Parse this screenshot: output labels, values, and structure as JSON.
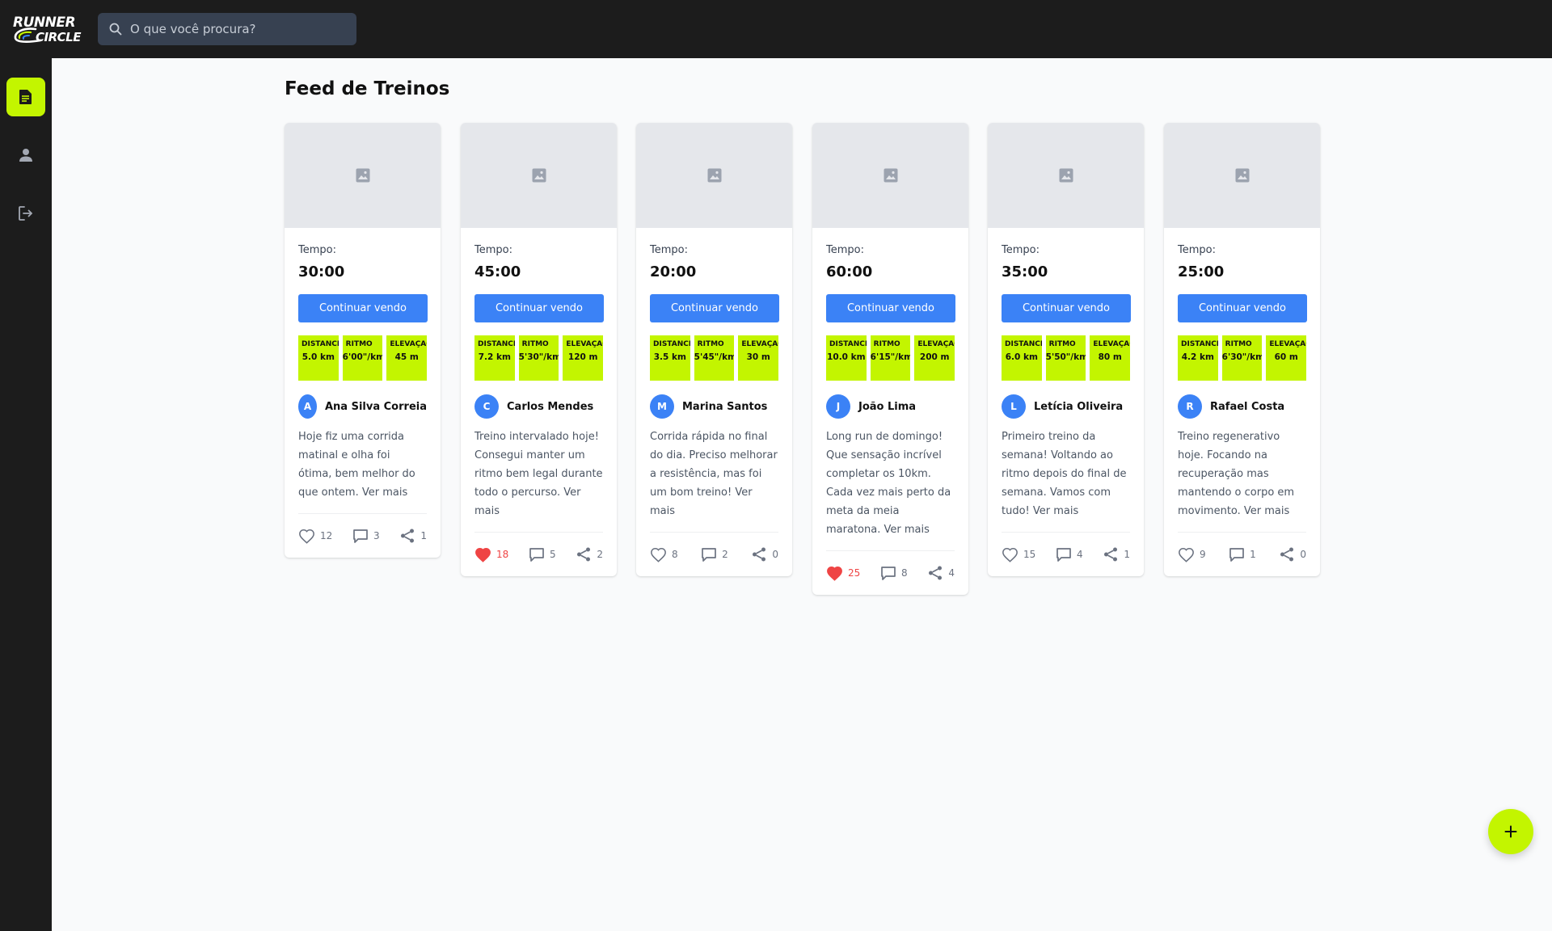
{
  "app": {
    "logo_line1": "RUNNER",
    "logo_line2": "CIRCLE"
  },
  "search": {
    "placeholder": "O que você procura?",
    "icon": "search-icon"
  },
  "sidebar": {
    "items": [
      {
        "icon": "feed-document-icon",
        "active": true
      },
      {
        "icon": "user-icon",
        "active": false
      },
      {
        "icon": "logout-icon",
        "active": false
      }
    ],
    "accent": "#c3f500"
  },
  "page_title": "Feed de Treinos",
  "colors": {
    "topbar": "#1c1c1c",
    "primary_button": "#3b82f6",
    "stat_bg": "#c3f500",
    "liked": "#ef4444"
  },
  "posts": [
    {
      "time_label": "Tempo:",
      "time": "30:00",
      "cta": "Continuar vendo",
      "stats": [
        {
          "label": "DISTÂNCIA",
          "value": "5.0 km"
        },
        {
          "label": "RITMO",
          "value": "6'00\"/km"
        },
        {
          "label": "ELEVAÇÃO",
          "value": "45 m"
        }
      ],
      "avatar": "A",
      "author": "Ana Silva Correia",
      "text": "Hoje fiz uma corrida matinal e olha foi ótima, bem melhor do que ontem. Ver mais",
      "likes": "12",
      "liked": false,
      "comments": "3",
      "shares": "1"
    },
    {
      "time_label": "Tempo:",
      "time": "45:00",
      "cta": "Continuar vendo",
      "stats": [
        {
          "label": "DISTÂNCIA",
          "value": "7.2 km"
        },
        {
          "label": "RITMO",
          "value": "5'30\"/km"
        },
        {
          "label": "ELEVAÇÃO",
          "value": "120 m"
        }
      ],
      "avatar": "C",
      "author": "Carlos Mendes",
      "text": "Treino intervalado hoje! Consegui manter um ritmo bem legal durante todo o percurso. Ver mais",
      "likes": "18",
      "liked": true,
      "comments": "5",
      "shares": "2"
    },
    {
      "time_label": "Tempo:",
      "time": "20:00",
      "cta": "Continuar vendo",
      "stats": [
        {
          "label": "DISTÂNCIA",
          "value": "3.5 km"
        },
        {
          "label": "RITMO",
          "value": "5'45\"/km"
        },
        {
          "label": "ELEVAÇÃO",
          "value": "30 m"
        }
      ],
      "avatar": "M",
      "author": "Marina Santos",
      "text": "Corrida rápida no final do dia. Preciso melhorar a resistência, mas foi um bom treino! Ver mais",
      "likes": "8",
      "liked": false,
      "comments": "2",
      "shares": "0"
    },
    {
      "time_label": "Tempo:",
      "time": "60:00",
      "cta": "Continuar vendo",
      "stats": [
        {
          "label": "DISTÂNCIA",
          "value": "10.0 km"
        },
        {
          "label": "RITMO",
          "value": "6'15\"/km"
        },
        {
          "label": "ELEVAÇÃO",
          "value": "200 m"
        }
      ],
      "avatar": "J",
      "author": "João Lima",
      "text": "Long run de domingo! Que sensação incrível completar os 10km. Cada vez mais perto da meta da meia maratona. Ver mais",
      "likes": "25",
      "liked": true,
      "comments": "8",
      "shares": "4"
    },
    {
      "time_label": "Tempo:",
      "time": "35:00",
      "cta": "Continuar vendo",
      "stats": [
        {
          "label": "DISTÂNCIA",
          "value": "6.0 km"
        },
        {
          "label": "RITMO",
          "value": "5'50\"/km"
        },
        {
          "label": "ELEVAÇÃO",
          "value": "80 m"
        }
      ],
      "avatar": "L",
      "author": "Letícia Oliveira",
      "text": "Primeiro treino da semana! Voltando ao ritmo depois do final de semana. Vamos com tudo! Ver mais",
      "likes": "15",
      "liked": false,
      "comments": "4",
      "shares": "1"
    },
    {
      "time_label": "Tempo:",
      "time": "25:00",
      "cta": "Continuar vendo",
      "stats": [
        {
          "label": "DISTÂNCIA",
          "value": "4.2 km"
        },
        {
          "label": "RITMO",
          "value": "6'30\"/km"
        },
        {
          "label": "ELEVAÇÃO",
          "value": "60 m"
        }
      ],
      "avatar": "R",
      "author": "Rafael Costa",
      "text": "Treino regenerativo hoje. Focando na recuperação mas mantendo o corpo em movimento. Ver mais",
      "likes": "9",
      "liked": false,
      "comments": "1",
      "shares": "0"
    }
  ],
  "fab": {
    "icon": "plus-icon"
  }
}
